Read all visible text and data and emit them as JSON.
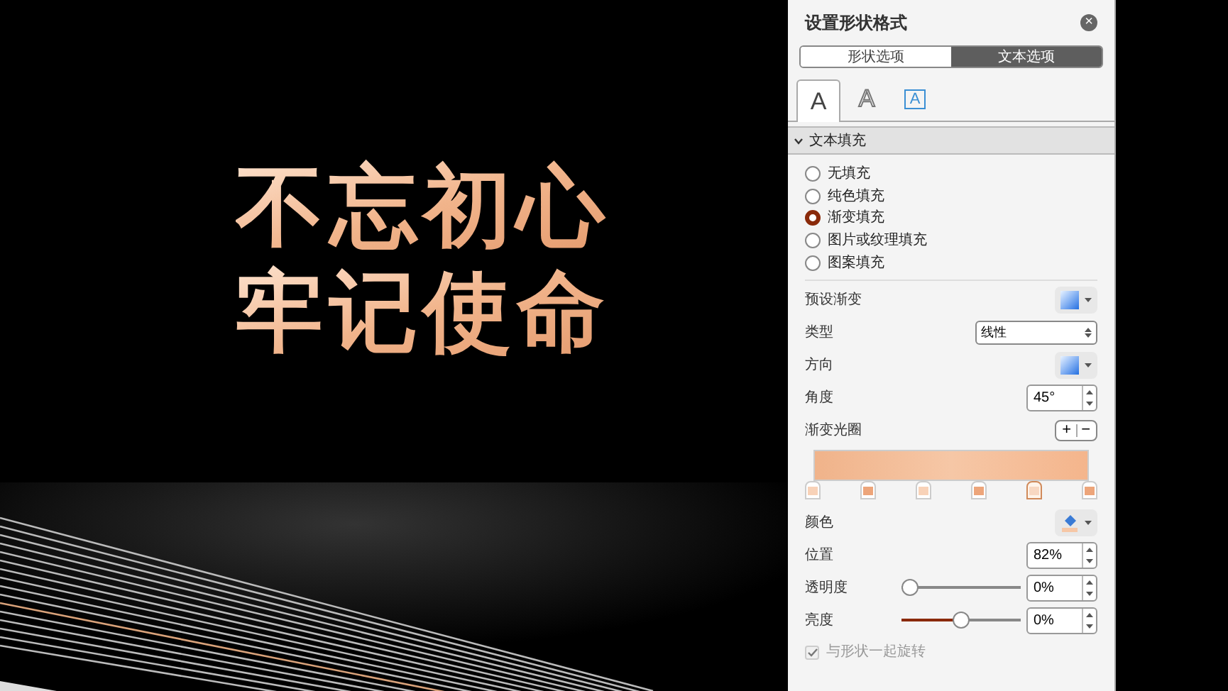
{
  "slide": {
    "title_lines": [
      "不忘初心",
      "牢记使命"
    ]
  },
  "panel": {
    "title": "设置形状格式",
    "close": "×",
    "segments": [
      {
        "label": "形状选项",
        "selected": false
      },
      {
        "label": "文本选项",
        "selected": true
      }
    ],
    "icon_tabs": [
      {
        "kind": "fill",
        "label": "A",
        "selected": true
      },
      {
        "kind": "outline",
        "label": "A",
        "selected": false
      },
      {
        "kind": "box",
        "label": "A",
        "selected": false
      }
    ],
    "section": {
      "title": "文本填充",
      "expanded": true
    },
    "fill_options": [
      {
        "label": "无填充",
        "selected": false
      },
      {
        "label": "纯色填充",
        "selected": false
      },
      {
        "label": "渐变填充",
        "selected": true
      },
      {
        "label": "图片或纹理填充",
        "selected": false
      },
      {
        "label": "图案填充",
        "selected": false
      }
    ],
    "preset_label": "预设渐变",
    "type_label": "类型",
    "type_value": "线性",
    "direction_label": "方向",
    "angle_label": "角度",
    "angle_value": "45°",
    "stops_label": "渐变光圈",
    "add": "+",
    "remove": "−",
    "stops": [
      {
        "color": "#f8d2b8",
        "selected": false
      },
      {
        "color": "#eda57a",
        "selected": false
      },
      {
        "color": "#f8d2b8",
        "selected": false
      },
      {
        "color": "#eda57a",
        "selected": false
      },
      {
        "color": "#f8d8c2",
        "selected": true
      },
      {
        "color": "#eda57a",
        "selected": false
      }
    ],
    "color_label": "颜色",
    "position_label": "位置",
    "position_value": "82%",
    "transparency": {
      "label": "透明度",
      "level": 0,
      "value": "0%"
    },
    "brightness": {
      "label": "亮度",
      "level": 0.5,
      "value": "0%"
    },
    "rotate": {
      "label": "与形状一起旋转",
      "checked": true,
      "disabled": true
    }
  }
}
